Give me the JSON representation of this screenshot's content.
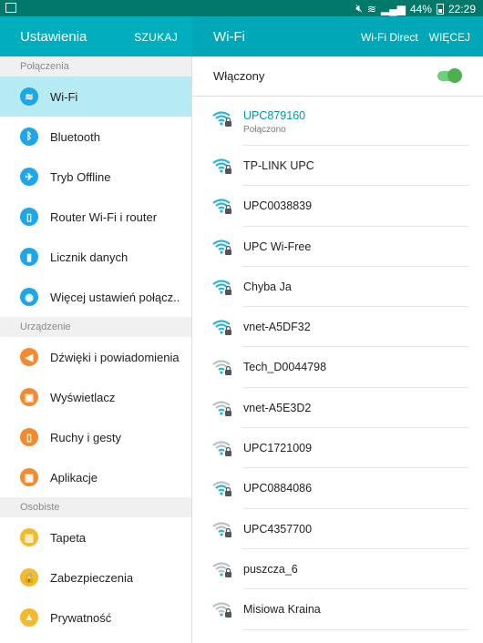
{
  "status_bar": {
    "battery": "44%",
    "time": "22:29"
  },
  "left_header": {
    "title": "Ustawienia",
    "action": "SZUKAJ"
  },
  "right_header": {
    "title": "Wi-Fi",
    "actions": [
      "Wi-Fi Direct",
      "WIĘCEJ"
    ]
  },
  "sections": [
    {
      "title": "Połączenia",
      "items": [
        {
          "label": "Wi-Fi",
          "icon": "wifi-icon",
          "color": "#1ea7e8",
          "glyph": "≋",
          "active": true
        },
        {
          "label": "Bluetooth",
          "icon": "bluetooth-icon",
          "color": "#1ea7e8",
          "glyph": "ᛒ"
        },
        {
          "label": "Tryb Offline",
          "icon": "airplane-icon",
          "color": "#1ea7e8",
          "glyph": "✈"
        },
        {
          "label": "Router Wi-Fi i router",
          "icon": "hotspot-icon",
          "color": "#1ea7e8",
          "glyph": "▯"
        },
        {
          "label": "Licznik danych",
          "icon": "data-usage-icon",
          "color": "#1ea7e8",
          "glyph": "▮"
        },
        {
          "label": "Więcej ustawień połącz..",
          "icon": "more-networks-icon",
          "color": "#1ea7e8",
          "glyph": "◉"
        }
      ]
    },
    {
      "title": "Urządzenie",
      "items": [
        {
          "label": "Dźwięki i powiadomienia",
          "icon": "sound-icon",
          "color": "#f28b30",
          "glyph": "◀"
        },
        {
          "label": "Wyświetlacz",
          "icon": "display-icon",
          "color": "#f28b30",
          "glyph": "▣"
        },
        {
          "label": "Ruchy i gesty",
          "icon": "motion-icon",
          "color": "#f28b30",
          "glyph": "▯"
        },
        {
          "label": "Aplikacje",
          "icon": "apps-icon",
          "color": "#f28b30",
          "glyph": "▦"
        }
      ]
    },
    {
      "title": "Osobiste",
      "items": [
        {
          "label": "Tapeta",
          "icon": "wallpaper-icon",
          "color": "#f5b92e",
          "glyph": "▨"
        },
        {
          "label": "Zabezpieczenia",
          "icon": "lock-icon",
          "color": "#f5b92e",
          "glyph": "🔒"
        },
        {
          "label": "Prywatność",
          "icon": "privacy-icon",
          "color": "#f5b92e",
          "glyph": "▲"
        }
      ]
    }
  ],
  "wifi": {
    "toggle_label": "Włączony",
    "enabled": true,
    "networks": [
      {
        "name": "UPC879160",
        "status": "Połączono",
        "strength": 4,
        "connected": true
      },
      {
        "name": "TP-LINK UPC",
        "strength": 4
      },
      {
        "name": "UPC0038839",
        "strength": 4
      },
      {
        "name": "UPC Wi-Free",
        "strength": 4
      },
      {
        "name": "Chyba Ja",
        "strength": 4
      },
      {
        "name": "vnet-A5DF32",
        "strength": 4
      },
      {
        "name": "Tech_D0044798",
        "strength": 2
      },
      {
        "name": "vnet-A5E3D2",
        "strength": 2
      },
      {
        "name": "UPC1721009",
        "strength": 2
      },
      {
        "name": "UPC0884086",
        "strength": 3
      },
      {
        "name": "UPC4357700",
        "strength": 2
      },
      {
        "name": "puszcza_6",
        "strength": 1
      },
      {
        "name": "Misiowa Kraina",
        "strength": 1
      }
    ]
  }
}
